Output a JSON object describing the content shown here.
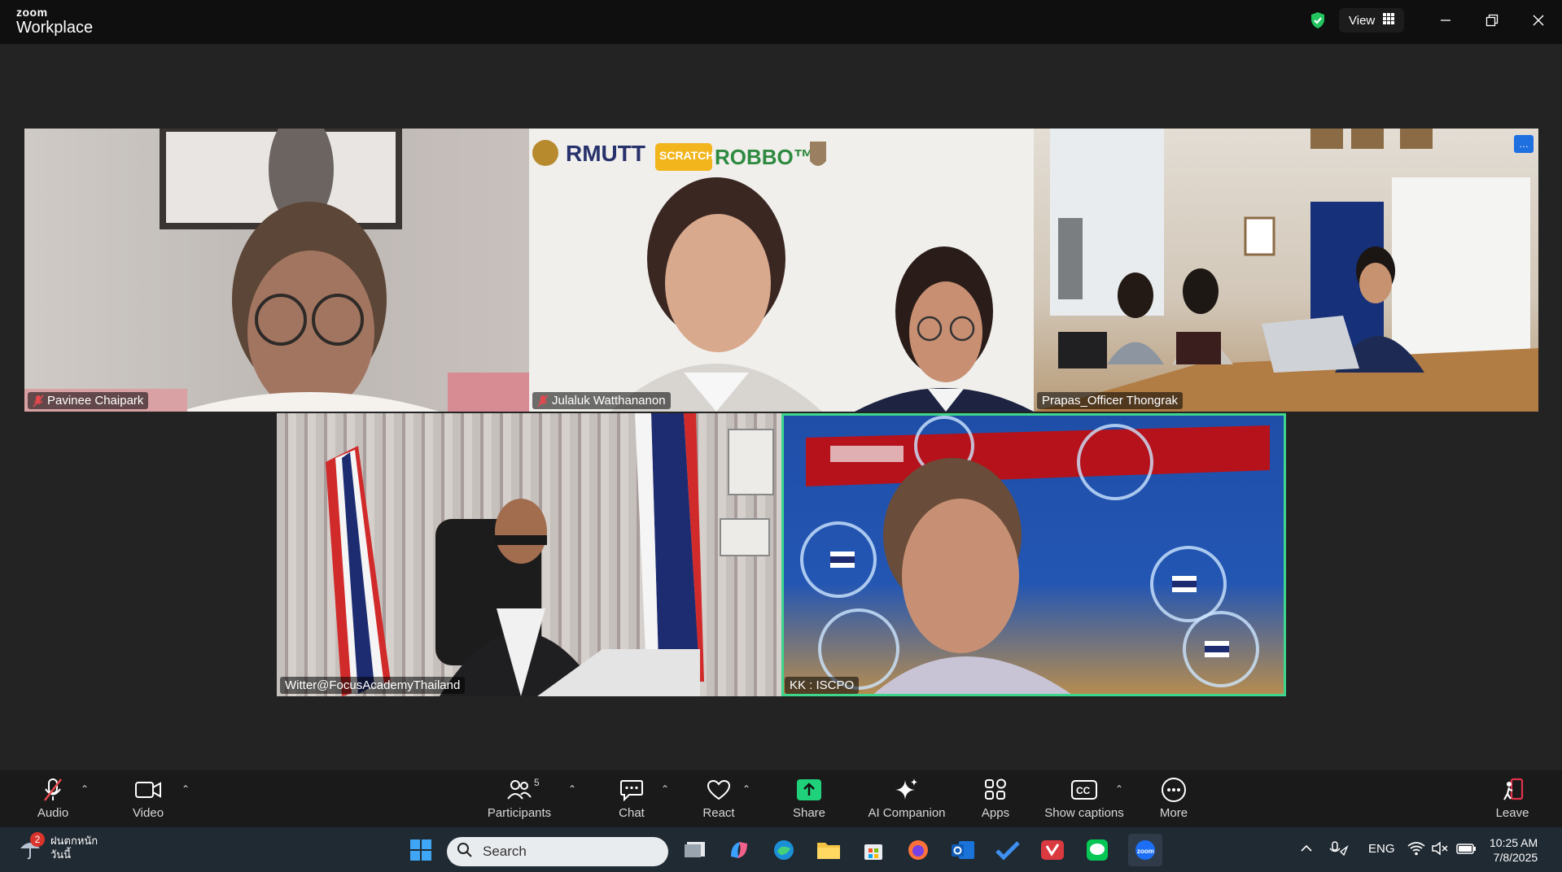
{
  "window": {
    "brand_top": "zoom",
    "brand_bottom": "Workplace",
    "view_label": "View"
  },
  "participants_tiles": [
    {
      "name": "Pavinee Chaipark",
      "muted": true
    },
    {
      "name": "Julaluk Watthananon",
      "muted": true,
      "logos": [
        "RMUTT",
        "SCRATCH",
        "ROBBO™"
      ]
    },
    {
      "name": "Prapas_Officer Thongrak",
      "muted": false
    },
    {
      "name": "Witter@FocusAcademyThailand",
      "muted": false
    },
    {
      "name": "KK : ISCPO",
      "muted": false,
      "active_speaker": true
    }
  ],
  "toolbar": {
    "audio": "Audio",
    "video": "Video",
    "participants": "Participants",
    "participants_count": "5",
    "chat": "Chat",
    "react": "React",
    "share": "Share",
    "ai_companion": "AI Companion",
    "apps": "Apps",
    "captions": "Show captions",
    "more": "More",
    "leave": "Leave"
  },
  "taskbar": {
    "weather_line1": "ฝนตกหนัก",
    "weather_line2": "วันนี้",
    "weather_badge": "2",
    "search_placeholder": "Search",
    "lang": "ENG",
    "time": "10:25 AM",
    "date": "7/8/2025"
  },
  "colors": {
    "accent_active": "#3dd68c",
    "share_green": "#1fd17a",
    "leave_red": "#e0334b",
    "shield_green": "#22c55e"
  }
}
